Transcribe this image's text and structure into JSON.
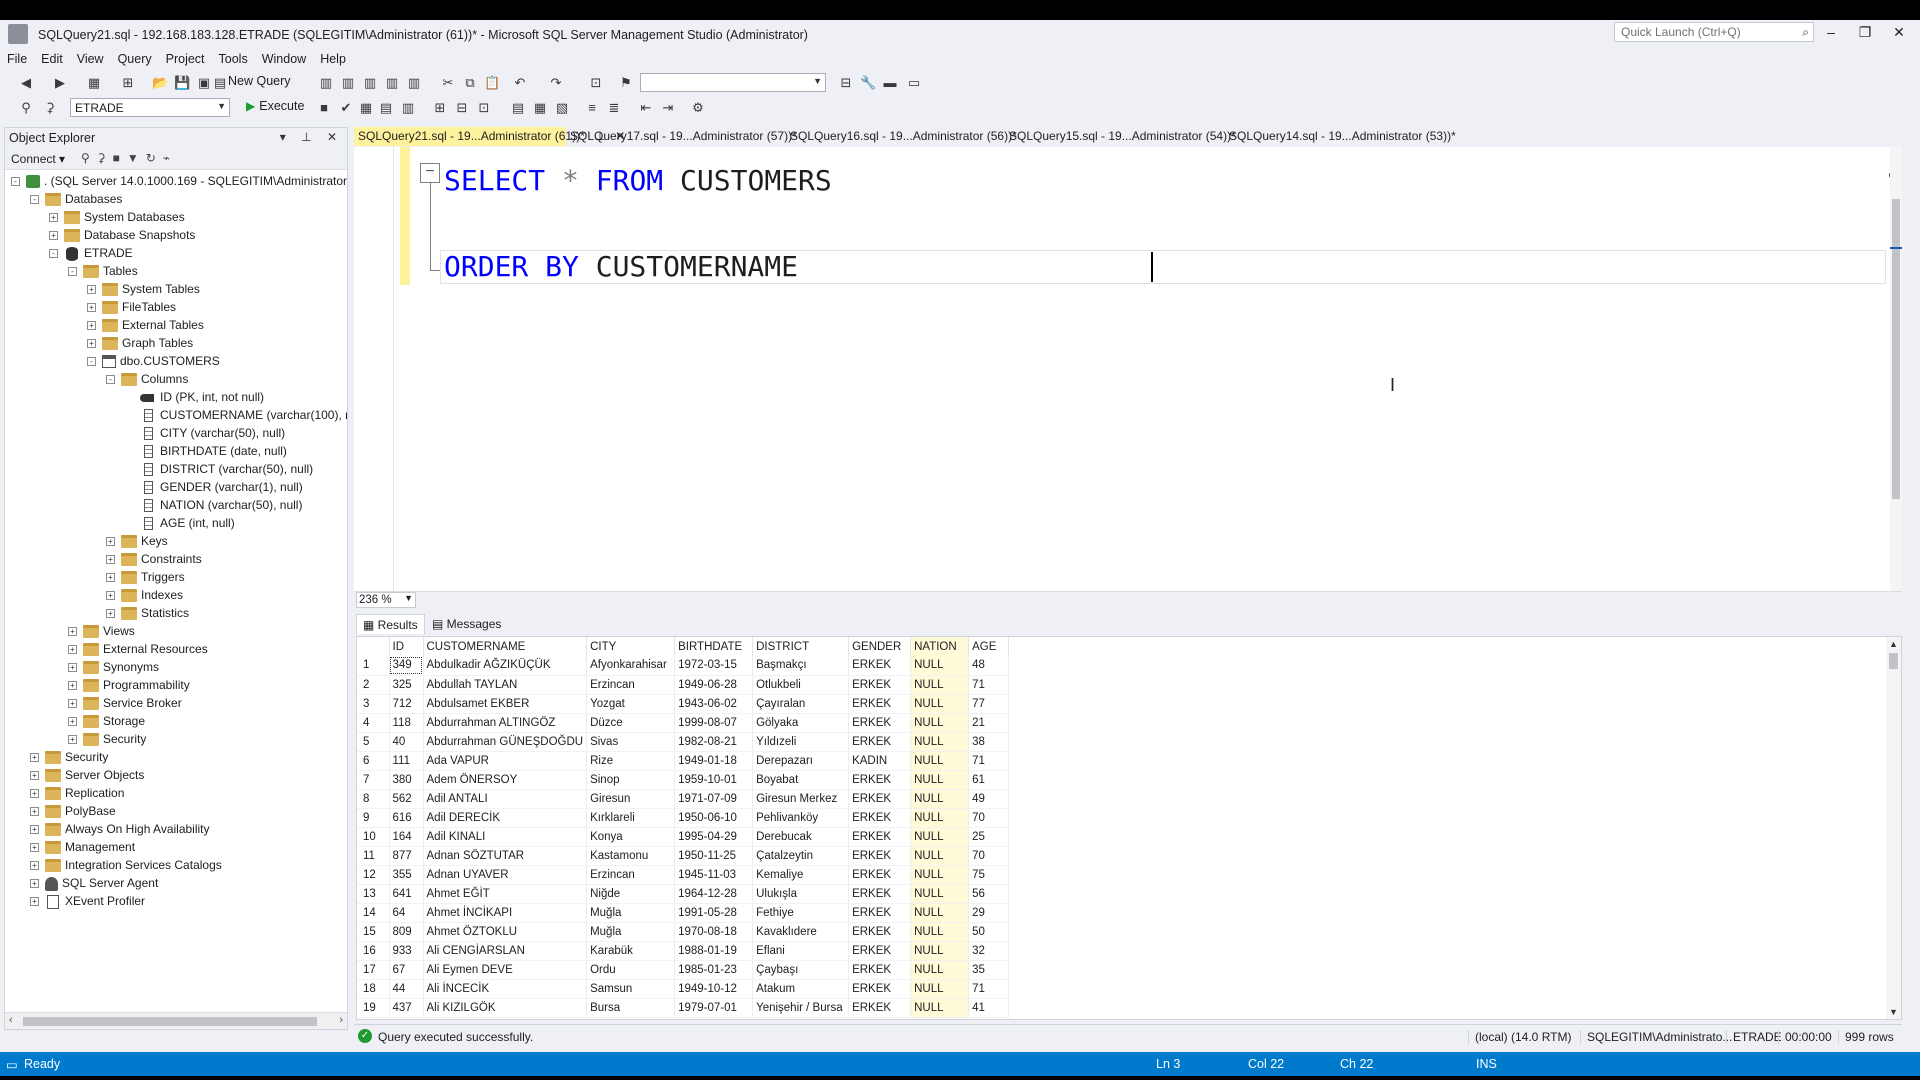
{
  "window": {
    "title": "SQLQuery21.sql - 192.168.183.128.ETRADE (SQLEGITIM\\Administrator (61))* - Microsoft SQL Server Management Studio (Administrator)",
    "quick_launch_placeholder": "Quick Launch (Ctrl+Q)"
  },
  "menu": [
    "File",
    "Edit",
    "View",
    "Query",
    "Project",
    "Tools",
    "Window",
    "Help"
  ],
  "toolbar": {
    "new_query_label": "New Query",
    "database_selected": "ETRADE",
    "execute_label": "Execute"
  },
  "object_explorer": {
    "title": "Object Explorer",
    "connect_label": "Connect",
    "tree": [
      {
        "label": ". (SQL Server 14.0.1000.169 - SQLEGITIM\\Administrator)",
        "level": 0,
        "expander": "-",
        "icon": "server-icon"
      },
      {
        "label": "Databases",
        "level": 1,
        "expander": "-",
        "icon": "folder-icon"
      },
      {
        "label": "System Databases",
        "level": 2,
        "expander": "+",
        "icon": "folder-icon"
      },
      {
        "label": "Database Snapshots",
        "level": 2,
        "expander": "+",
        "icon": "folder-icon"
      },
      {
        "label": "ETRADE",
        "level": 2,
        "expander": "-",
        "icon": "database-icon"
      },
      {
        "label": "Tables",
        "level": 3,
        "expander": "-",
        "icon": "folder-icon"
      },
      {
        "label": "System Tables",
        "level": 4,
        "expander": "+",
        "icon": "folder-icon"
      },
      {
        "label": "FileTables",
        "level": 4,
        "expander": "+",
        "icon": "folder-icon"
      },
      {
        "label": "External Tables",
        "level": 4,
        "expander": "+",
        "icon": "folder-icon"
      },
      {
        "label": "Graph Tables",
        "level": 4,
        "expander": "+",
        "icon": "folder-icon"
      },
      {
        "label": "dbo.CUSTOMERS",
        "level": 4,
        "expander": "-",
        "icon": "table-icon"
      },
      {
        "label": "Columns",
        "level": 5,
        "expander": "-",
        "icon": "folder-icon"
      },
      {
        "label": "ID (PK, int, not null)",
        "level": 6,
        "expander": "",
        "icon": "key-icon"
      },
      {
        "label": "CUSTOMERNAME (varchar(100), nu",
        "level": 6,
        "expander": "",
        "icon": "column-icon"
      },
      {
        "label": "CITY (varchar(50), null)",
        "level": 6,
        "expander": "",
        "icon": "column-icon"
      },
      {
        "label": "BIRTHDATE (date, null)",
        "level": 6,
        "expander": "",
        "icon": "column-icon"
      },
      {
        "label": "DISTRICT (varchar(50), null)",
        "level": 6,
        "expander": "",
        "icon": "column-icon"
      },
      {
        "label": "GENDER (varchar(1), null)",
        "level": 6,
        "expander": "",
        "icon": "column-icon"
      },
      {
        "label": "NATION (varchar(50), null)",
        "level": 6,
        "expander": "",
        "icon": "column-icon"
      },
      {
        "label": "AGE (int, null)",
        "level": 6,
        "expander": "",
        "icon": "column-icon"
      },
      {
        "label": "Keys",
        "level": 5,
        "expander": "+",
        "icon": "folder-icon"
      },
      {
        "label": "Constraints",
        "level": 5,
        "expander": "+",
        "icon": "folder-icon"
      },
      {
        "label": "Triggers",
        "level": 5,
        "expander": "+",
        "icon": "folder-icon"
      },
      {
        "label": "Indexes",
        "level": 5,
        "expander": "+",
        "icon": "folder-icon"
      },
      {
        "label": "Statistics",
        "level": 5,
        "expander": "+",
        "icon": "folder-icon"
      },
      {
        "label": "Views",
        "level": 3,
        "expander": "+",
        "icon": "folder-icon"
      },
      {
        "label": "External Resources",
        "level": 3,
        "expander": "+",
        "icon": "folder-icon"
      },
      {
        "label": "Synonyms",
        "level": 3,
        "expander": "+",
        "icon": "folder-icon"
      },
      {
        "label": "Programmability",
        "level": 3,
        "expander": "+",
        "icon": "folder-icon"
      },
      {
        "label": "Service Broker",
        "level": 3,
        "expander": "+",
        "icon": "folder-icon"
      },
      {
        "label": "Storage",
        "level": 3,
        "expander": "+",
        "icon": "folder-icon"
      },
      {
        "label": "Security",
        "level": 3,
        "expander": "+",
        "icon": "folder-icon"
      },
      {
        "label": "Security",
        "level": 1,
        "expander": "+",
        "icon": "folder-icon"
      },
      {
        "label": "Server Objects",
        "level": 1,
        "expander": "+",
        "icon": "folder-icon"
      },
      {
        "label": "Replication",
        "level": 1,
        "expander": "+",
        "icon": "folder-icon"
      },
      {
        "label": "PolyBase",
        "level": 1,
        "expander": "+",
        "icon": "folder-icon"
      },
      {
        "label": "Always On High Availability",
        "level": 1,
        "expander": "+",
        "icon": "folder-icon"
      },
      {
        "label": "Management",
        "level": 1,
        "expander": "+",
        "icon": "folder-icon"
      },
      {
        "label": "Integration Services Catalogs",
        "level": 1,
        "expander": "+",
        "icon": "folder-icon"
      },
      {
        "label": "SQL Server Agent",
        "level": 1,
        "expander": "+",
        "icon": "agent-icon"
      },
      {
        "label": "XEvent Profiler",
        "level": 1,
        "expander": "+",
        "icon": "xevent-icon"
      }
    ]
  },
  "doc_tabs": [
    {
      "label": "SQLQuery21.sql - 19...Administrator (61))*",
      "active": true
    },
    {
      "label": "SQLQuery17.sql - 19...Administrator (57))*",
      "active": false
    },
    {
      "label": "SQLQuery16.sql - 19...Administrator (56))*",
      "active": false
    },
    {
      "label": "SQLQuery15.sql - 19...Administrator (54))*",
      "active": false
    },
    {
      "label": "SQLQuery14.sql - 19...Administrator (53))*",
      "active": false
    }
  ],
  "editor": {
    "line1": {
      "kw1": "SELECT",
      "op": "*",
      "kw2": "FROM",
      "ident": "CUSTOMERS"
    },
    "line3": {
      "kw1": "ORDER BY",
      "ident": "CUSTOMERNAME"
    },
    "zoom": "236 %"
  },
  "results": {
    "tabs": [
      "Results",
      "Messages"
    ],
    "columns": [
      "ID",
      "CUSTOMERNAME",
      "CITY",
      "BIRTHDATE",
      "DISTRICT",
      "GENDER",
      "NATION",
      "AGE"
    ],
    "rows": [
      [
        "1",
        "349",
        "Abdulkadir AĞZIKÜÇÜK",
        "Afyonkarahisar",
        "1972-03-15",
        "Başmakçı",
        "ERKEK",
        "NULL",
        "48"
      ],
      [
        "2",
        "325",
        "Abdullah TAYLAN",
        "Erzincan",
        "1949-06-28",
        "Otlukbeli",
        "ERKEK",
        "NULL",
        "71"
      ],
      [
        "3",
        "712",
        "Abdulsamet EKBER",
        "Yozgat",
        "1943-06-02",
        "Çayıralan",
        "ERKEK",
        "NULL",
        "77"
      ],
      [
        "4",
        "118",
        "Abdurrahman ALTINGÖZ",
        "Düzce",
        "1999-08-07",
        "Gölyaka",
        "ERKEK",
        "NULL",
        "21"
      ],
      [
        "5",
        "40",
        "Abdurrahman GÜNEŞDOĞDU",
        "Sivas",
        "1982-08-21",
        "Yıldızeli",
        "ERKEK",
        "NULL",
        "38"
      ],
      [
        "6",
        "111",
        "Ada VAPUR",
        "Rize",
        "1949-01-18",
        "Derepazarı",
        "KADIN",
        "NULL",
        "71"
      ],
      [
        "7",
        "380",
        "Adem ÖNERSOY",
        "Sinop",
        "1959-10-01",
        "Boyabat",
        "ERKEK",
        "NULL",
        "61"
      ],
      [
        "8",
        "562",
        "Adil ANTALI",
        "Giresun",
        "1971-07-09",
        "Giresun Merkez",
        "ERKEK",
        "NULL",
        "49"
      ],
      [
        "9",
        "616",
        "Adil DERECİK",
        "Kırklareli",
        "1950-06-10",
        "Pehlivanköy",
        "ERKEK",
        "NULL",
        "70"
      ],
      [
        "10",
        "164",
        "Adil KINALI",
        "Konya",
        "1995-04-29",
        "Derebucak",
        "ERKEK",
        "NULL",
        "25"
      ],
      [
        "11",
        "877",
        "Adnan SÖZTUTAR",
        "Kastamonu",
        "1950-11-25",
        "Çatalzeytin",
        "ERKEK",
        "NULL",
        "70"
      ],
      [
        "12",
        "355",
        "Adnan UYAVER",
        "Erzincan",
        "1945-11-03",
        "Kemaliye",
        "ERKEK",
        "NULL",
        "75"
      ],
      [
        "13",
        "641",
        "Ahmet EĞİT",
        "Niğde",
        "1964-12-28",
        "Ulukışla",
        "ERKEK",
        "NULL",
        "56"
      ],
      [
        "14",
        "64",
        "Ahmet İNCİKAPI",
        "Muğla",
        "1991-05-28",
        "Fethiye",
        "ERKEK",
        "NULL",
        "29"
      ],
      [
        "15",
        "809",
        "Ahmet ÖZTOKLU",
        "Muğla",
        "1970-08-18",
        "Kavaklıdere",
        "ERKEK",
        "NULL",
        "50"
      ],
      [
        "16",
        "933",
        "Ali CENGİARSLAN",
        "Karabük",
        "1988-01-19",
        "Eflani",
        "ERKEK",
        "NULL",
        "32"
      ],
      [
        "17",
        "67",
        "Ali Eymen DEVE",
        "Ordu",
        "1985-01-23",
        "Çaybaşı",
        "ERKEK",
        "NULL",
        "35"
      ],
      [
        "18",
        "44",
        "Ali İNCECİK",
        "Samsun",
        "1949-10-12",
        "Atakum",
        "ERKEK",
        "NULL",
        "71"
      ],
      [
        "19",
        "437",
        "Ali KIZILGÖK",
        "Bursa",
        "1979-07-01",
        "Yenişehir / Bursa",
        "ERKEK",
        "NULL",
        "41"
      ]
    ]
  },
  "query_status": {
    "message": "Query executed successfully.",
    "server": "(local) (14.0 RTM)",
    "user": "SQLEGITIM\\Administrato...",
    "database": "ETRADE",
    "elapsed": "00:00:00",
    "rows": "999 rows"
  },
  "status_bar": {
    "state": "Ready",
    "line": "Ln 3",
    "col": "Col 22",
    "ch": "Ch 22",
    "mode": "INS"
  },
  "colors": {
    "accent": "#007acc",
    "active_tab": "#fff29d",
    "keyword": "#0000ff",
    "success": "#1f9a2e"
  }
}
